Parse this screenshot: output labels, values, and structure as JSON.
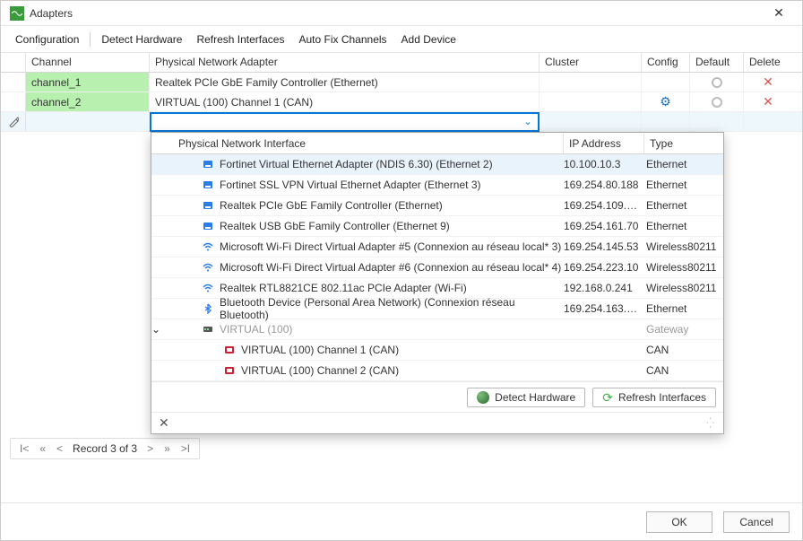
{
  "window": {
    "title": "Adapters"
  },
  "menu": {
    "configuration": "Configuration",
    "detect_hardware": "Detect Hardware",
    "refresh_interfaces": "Refresh Interfaces",
    "auto_fix_channels": "Auto Fix Channels",
    "add_device": "Add Device"
  },
  "grid": {
    "headers": {
      "channel": "Channel",
      "adapter": "Physical Network Adapter",
      "cluster": "Cluster",
      "config": "Config",
      "default": "Default",
      "delete": "Delete"
    },
    "rows": [
      {
        "channel": "channel_1",
        "adapter": "Realtek PCIe GbE Family Controller (Ethernet)",
        "has_config": false
      },
      {
        "channel": "channel_2",
        "adapter": "VIRTUAL (100) Channel 1 (CAN)",
        "has_config": true
      }
    ]
  },
  "popup": {
    "headers": {
      "name": "Physical Network Interface",
      "ip": "IP Address",
      "type": "Type"
    },
    "rows": [
      {
        "icon": "eth",
        "name": "Fortinet Virtual Ethernet Adapter (NDIS 6.30) (Ethernet 2)",
        "ip": "10.100.10.3",
        "type": "Ethernet",
        "selected": true
      },
      {
        "icon": "eth",
        "name": "Fortinet SSL VPN Virtual Ethernet Adapter (Ethernet 3)",
        "ip": "169.254.80.188",
        "type": "Ethernet"
      },
      {
        "icon": "eth",
        "name": "Realtek PCIe GbE Family Controller (Ethernet)",
        "ip": "169.254.109.…",
        "type": "Ethernet"
      },
      {
        "icon": "eth",
        "name": "Realtek USB GbE Family Controller (Ethernet 9)",
        "ip": "169.254.161.70",
        "type": "Ethernet"
      },
      {
        "icon": "wifi",
        "name": "Microsoft Wi-Fi Direct Virtual Adapter #5 (Connexion au réseau local* 3)",
        "ip": "169.254.145.53",
        "type": "Wireless80211"
      },
      {
        "icon": "wifi",
        "name": "Microsoft Wi-Fi Direct Virtual Adapter #6 (Connexion au réseau local* 4)",
        "ip": "169.254.223.10",
        "type": "Wireless80211"
      },
      {
        "icon": "wifi",
        "name": "Realtek RTL8821CE 802.11ac PCIe Adapter (Wi-Fi)",
        "ip": "192.168.0.241",
        "type": "Wireless80211"
      },
      {
        "icon": "bt",
        "name": "Bluetooth Device (Personal Area Network) (Connexion réseau Bluetooth)",
        "ip": "169.254.163.…",
        "type": "Ethernet"
      },
      {
        "icon": "gw",
        "name": "VIRTUAL (100)",
        "ip": "",
        "type": "Gateway",
        "group": true
      },
      {
        "icon": "can",
        "name": "VIRTUAL (100) Channel 1 (CAN)",
        "ip": "",
        "type": "CAN",
        "child": true
      },
      {
        "icon": "can",
        "name": "VIRTUAL (100) Channel 2 (CAN)",
        "ip": "",
        "type": "CAN",
        "child": true
      }
    ],
    "detect_button": "Detect Hardware",
    "refresh_button": "Refresh Interfaces"
  },
  "pager": {
    "text": "Record 3 of 3"
  },
  "dialog": {
    "ok": "OK",
    "cancel": "Cancel"
  }
}
